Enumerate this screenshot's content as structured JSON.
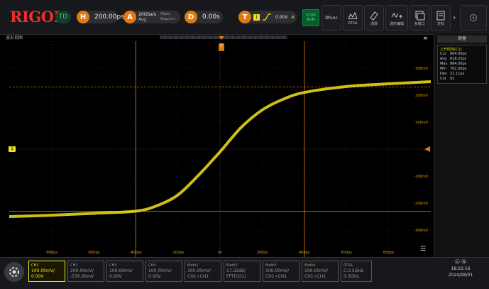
{
  "top": {
    "logo": "RIGOL",
    "mode": "TD",
    "h_label": "H",
    "timebase": "200.00ps/",
    "a_label": "A",
    "sample_rate": "20GSa/s",
    "acq_mode": "Avg",
    "mem_depth": "40pts",
    "status_text": "Stop/cxr",
    "d_label": "D",
    "delay": "0.00s",
    "t_label": "T",
    "trig_ch": "1",
    "trig_level": "0.00V",
    "trig_a": "A",
    "stop_run": "STOP\nRUN",
    "buttons": [
      "Dfunc",
      "RTSA",
      "清除",
      "波形编辑",
      "多窗口",
      "定标"
    ]
  },
  "screen": {
    "title": "波形视图",
    "trigger_marker": "T",
    "ch1_marker": "1",
    "time_labels": [
      "-800ps",
      "-600ps",
      "-400ps",
      "-200ps",
      "0s",
      "200ps",
      "400ps",
      "600ps",
      "800ps"
    ],
    "volt_labels": [
      "300mV",
      "200mV",
      "100mV",
      "-100mV",
      "-200mV",
      "-300mV"
    ]
  },
  "panel": {
    "title": "测量",
    "meas_name": "上升时间(C1)",
    "rows": [
      {
        "k": "Cur",
        "v": "864.00ps"
      },
      {
        "k": "Avg",
        "v": "818.25ps"
      },
      {
        "k": "Max",
        "v": "864.00ps"
      },
      {
        "k": "Min",
        "v": "762.00ps"
      },
      {
        "k": "Dev",
        "v": "21.11ps"
      },
      {
        "k": "Cnt",
        "v": "91"
      }
    ]
  },
  "bottom": {
    "channels": [
      {
        "name": "CH1",
        "line1": "100.00mV/",
        "line2": "0.00V"
      },
      {
        "name": "CH2",
        "line1": "200.00mV/",
        "line2": "-376.00mV"
      },
      {
        "name": "CH3",
        "line1": "100.00mV/",
        "line2": "0.00V"
      },
      {
        "name": "CH4",
        "line1": "100.00mV/",
        "line2": "0.00V"
      },
      {
        "name": "Math1",
        "line1": "300.00mV/",
        "line2": "CH1+CH1"
      },
      {
        "name": "Math2",
        "line1": "17.32dB/",
        "line2": "FFT(CH1)"
      },
      {
        "name": "Math3",
        "line1": "500.00mV/",
        "line2": "CH1+CH1"
      },
      {
        "name": "Math4",
        "line1": "500.00mV/",
        "line2": "CH1+CH1"
      },
      {
        "name": "RTSA",
        "line1": "C:3.5GHz",
        "line2": "S:3GHz"
      }
    ],
    "clock_time": "18:22:16",
    "clock_date": "2024/08/01"
  },
  "colors": {
    "ch1": "#f0e21a",
    "marker": "#e07a10",
    "grid": "#3a3a3a",
    "logo": "#f22c2c"
  },
  "chart_data": {
    "type": "line",
    "x_unit": "ps",
    "y_unit": "mV",
    "xlim": [
      -1000,
      1000
    ],
    "ylim": [
      -400,
      400
    ],
    "series": [
      {
        "x": [
          -1000,
          -800,
          -600,
          -400,
          -300,
          -200,
          -100,
          0,
          100,
          200,
          300,
          400,
          600,
          800,
          1000
        ],
        "values": [
          -250,
          -245,
          -238,
          -230,
          -210,
          -170,
          -95,
          -10,
          80,
          145,
          185,
          210,
          232,
          242,
          250
        ]
      }
    ]
  }
}
